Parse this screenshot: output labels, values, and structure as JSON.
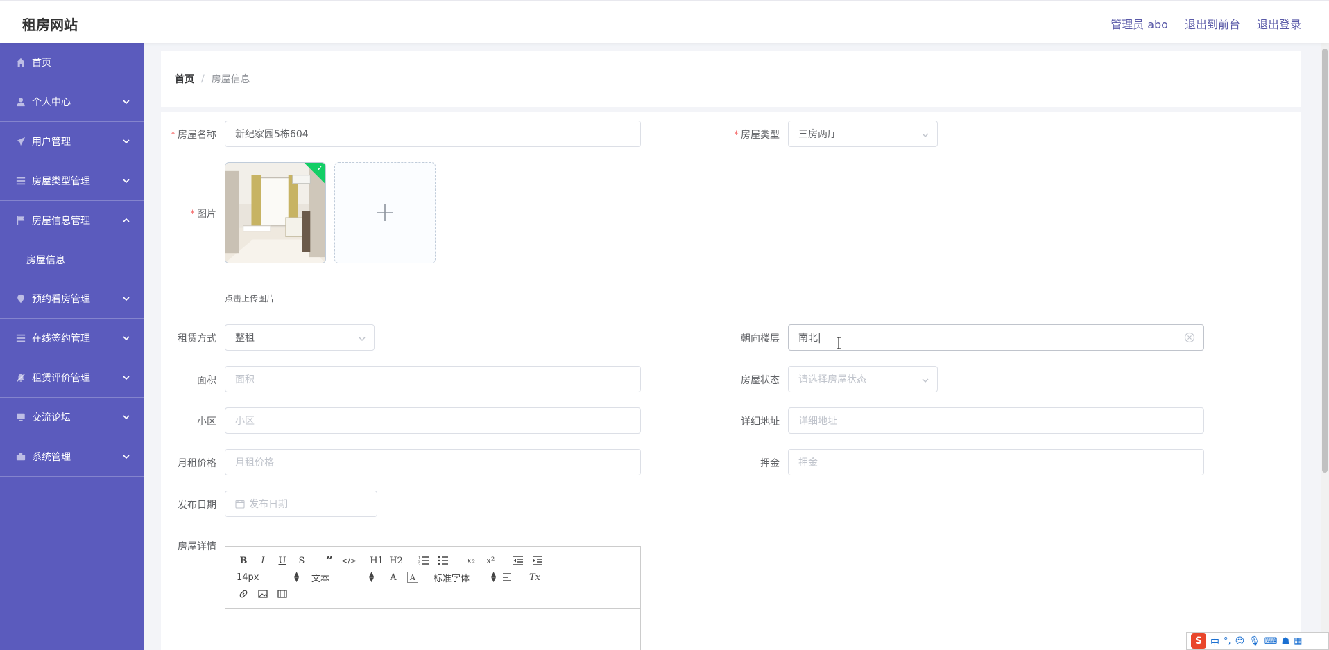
{
  "header": {
    "brand": "租房网站",
    "admin_label": "管理员 abo",
    "to_front": "退出到前台",
    "logout": "退出登录"
  },
  "sidebar": {
    "items": [
      {
        "label": "首页",
        "icon": "home-icon"
      },
      {
        "label": "个人中心",
        "icon": "user-icon"
      },
      {
        "label": "用户管理",
        "icon": "send-icon"
      },
      {
        "label": "房屋类型管理",
        "icon": "list-icon"
      },
      {
        "label": "房屋信息管理",
        "icon": "flag-icon"
      },
      {
        "label": "预约看房管理",
        "icon": "location-icon"
      },
      {
        "label": "在线签约管理",
        "icon": "list-icon"
      },
      {
        "label": "租赁评价管理",
        "icon": "bell-off-icon"
      },
      {
        "label": "交流论坛",
        "icon": "monitor-icon"
      },
      {
        "label": "系统管理",
        "icon": "briefcase-icon"
      }
    ],
    "submenu_label": "房屋信息"
  },
  "breadcrumb": {
    "home": "首页",
    "separator": "/",
    "current": "房屋信息"
  },
  "form": {
    "name": {
      "label": "房屋名称",
      "value": "新纪家园5栋604"
    },
    "type": {
      "label": "房屋类型",
      "value": "三房两厅"
    },
    "image": {
      "label": "图片",
      "tip": "点击上传图片"
    },
    "rent_mode": {
      "label": "租赁方式",
      "value": "整租"
    },
    "orientation": {
      "label": "朝向楼层",
      "value": "南北|"
    },
    "area": {
      "label": "面积",
      "placeholder": "面积"
    },
    "status": {
      "label": "房屋状态",
      "placeholder": "请选择房屋状态"
    },
    "community": {
      "label": "小区",
      "placeholder": "小区"
    },
    "address": {
      "label": "详细地址",
      "placeholder": "详细地址"
    },
    "price": {
      "label": "月租价格",
      "placeholder": "月租价格"
    },
    "deposit": {
      "label": "押金",
      "placeholder": "押金"
    },
    "publish_date": {
      "label": "发布日期",
      "placeholder": "发布日期"
    },
    "details": {
      "label": "房屋详情"
    }
  },
  "editor": {
    "font_size": "14px",
    "text_style": "文本",
    "font_family": "标准字体",
    "buttons": {
      "bold": "B",
      "italic": "I",
      "underline": "U",
      "strike": "S",
      "quote": "”",
      "code": "</>",
      "h1": "H1",
      "h2": "H2",
      "sub": "x₂",
      "sup": "x²",
      "clear": "Tx"
    }
  },
  "ime": {
    "logo": "S",
    "lang": "中",
    "punct": "°,"
  }
}
